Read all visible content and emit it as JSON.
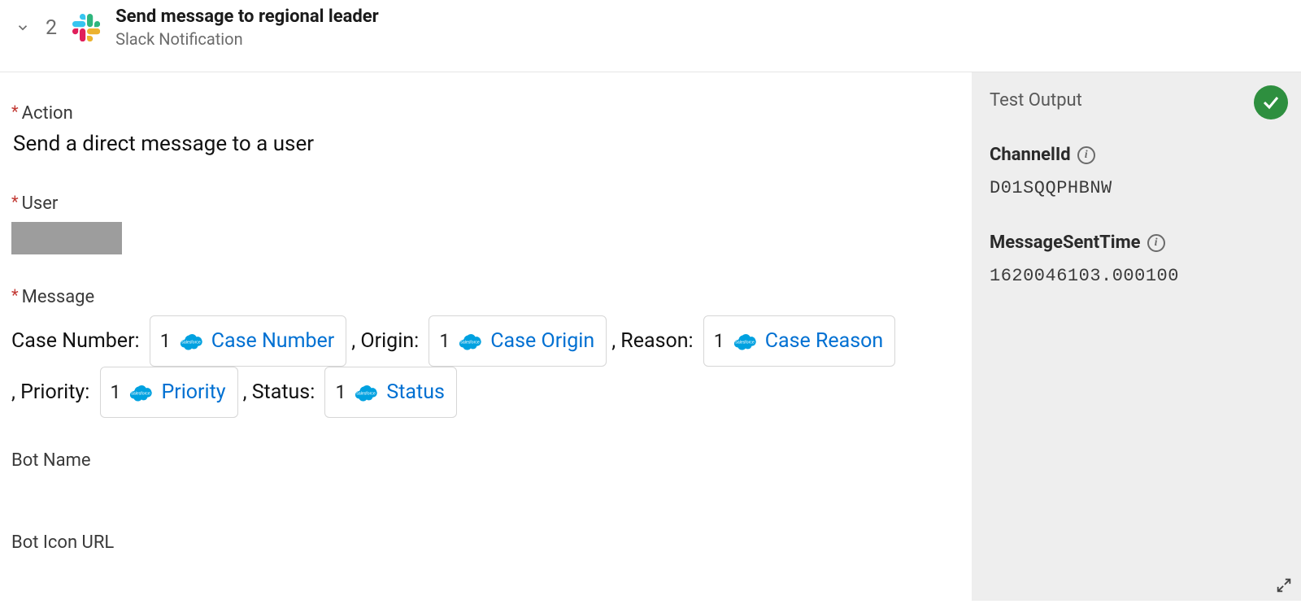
{
  "header": {
    "step_number": "2",
    "title": "Send message to regional leader",
    "subtitle": "Slack Notification"
  },
  "form": {
    "action": {
      "label": "Action",
      "value": "Send a direct message to a user"
    },
    "user": {
      "label": "User"
    },
    "message": {
      "label": "Message",
      "parts": [
        {
          "type": "text",
          "value": "Case Number: "
        },
        {
          "type": "token",
          "index": "1",
          "source": "salesforce",
          "name": "Case Number"
        },
        {
          "type": "text",
          "value": ", Origin: "
        },
        {
          "type": "token",
          "index": "1",
          "source": "salesforce",
          "name": "Case Origin"
        },
        {
          "type": "text",
          "value": ", Reason: "
        },
        {
          "type": "token",
          "index": "1",
          "source": "salesforce",
          "name": "Case Reason"
        },
        {
          "type": "text",
          "value": ", Priority: "
        },
        {
          "type": "token",
          "index": "1",
          "source": "salesforce",
          "name": "Priority"
        },
        {
          "type": "text",
          "value": ", Status: "
        },
        {
          "type": "token",
          "index": "1",
          "source": "salesforce",
          "name": "Status"
        }
      ]
    },
    "bot_name": {
      "label": "Bot Name"
    },
    "bot_icon_url": {
      "label": "Bot Icon URL"
    }
  },
  "output": {
    "heading": "Test Output",
    "status": "success",
    "fields": [
      {
        "name": "ChannelId",
        "value": "D01SQQPHBNW"
      },
      {
        "name": "MessageSentTime",
        "value": "1620046103.000100"
      }
    ]
  }
}
